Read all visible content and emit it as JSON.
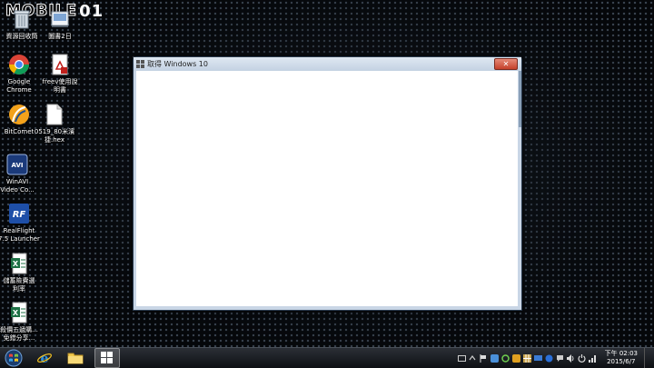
{
  "watermark": {
    "text": "MOBILE",
    "num": "01"
  },
  "desktop_icons": [
    {
      "name": "recycle-bin",
      "label": "資源回收筒"
    },
    {
      "name": "pictures",
      "label": "圖書2日"
    },
    {
      "name": "google-chrome",
      "label": "Google\nChrome"
    },
    {
      "name": "pdf-document",
      "label": "freev使用說\n明書"
    },
    {
      "name": "bitcomet",
      "label": "BitComet"
    },
    {
      "name": "hex-file",
      "label": "0519_80米濱\n捷.hex"
    },
    {
      "name": "winavi",
      "label": "WinAVI\nVideo Co..."
    },
    {
      "name": "realflight",
      "label": "RealFlight\n7.5 Launcher"
    },
    {
      "name": "spreadsheet-1",
      "label": "儲蓄險費選\n利率"
    },
    {
      "name": "spreadsheet-2",
      "label": "殺價五遞購...\n免錯分享..."
    }
  ],
  "window": {
    "title": "取得 Windows 10",
    "close_label": "✕"
  },
  "taskbar": {
    "apps": [
      "internet-explorer",
      "file-explorer",
      "windows-store"
    ],
    "clock_time": "下午 02:03",
    "clock_date": "2015/6/7"
  }
}
